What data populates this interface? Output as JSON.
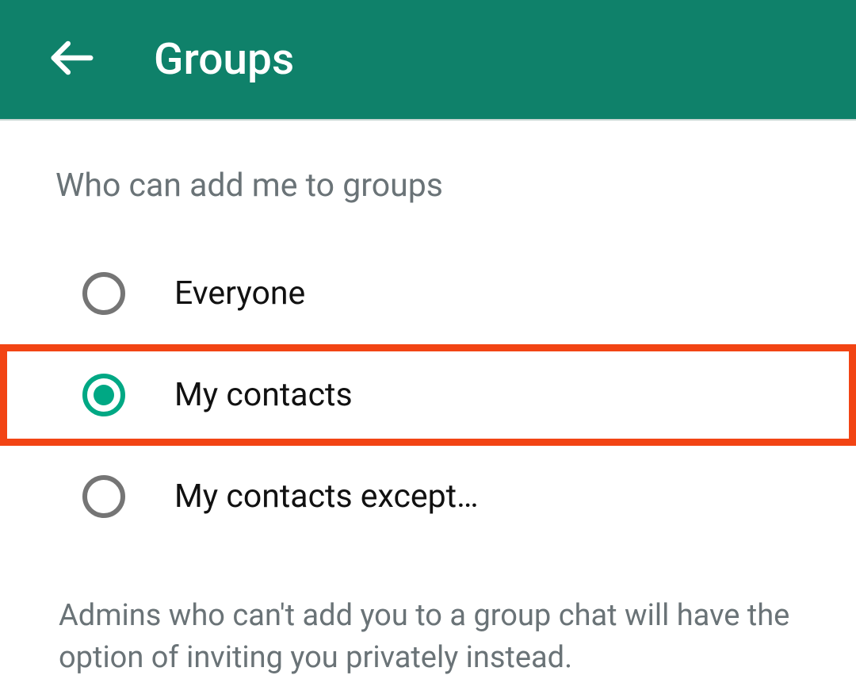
{
  "header": {
    "title": "Groups"
  },
  "section": {
    "title": "Who can add me to groups"
  },
  "options": [
    {
      "label": "Everyone",
      "selected": false,
      "highlighted": false
    },
    {
      "label": "My contacts",
      "selected": true,
      "highlighted": true
    },
    {
      "label": "My contacts except…",
      "selected": false,
      "highlighted": false
    }
  ],
  "description": "Admins who can't add you to a group chat will have the option of inviting you privately instead.",
  "colors": {
    "headerBg": "#0f816a",
    "accent": "#00a884",
    "highlight": "#f24414",
    "textSecondary": "#6a7377"
  }
}
